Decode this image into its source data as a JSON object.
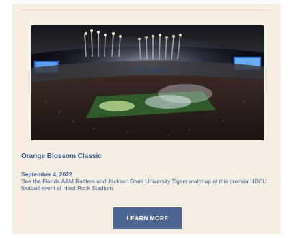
{
  "event": {
    "image_alt": "Hard Rock Stadium at night with fireworks above the field",
    "title": "Orange Blossom Classic",
    "date": "September 4, 2022",
    "description": "See the Florida A&M Rattlers and Jackson State University Tigers matchup at this premier HBCU football event at Hard Rock Stadium.",
    "cta_label": "LEARN MORE"
  },
  "colors": {
    "card_background": "#f5eee3",
    "accent_text": "#3b5b92",
    "button": "#4c6691",
    "divider": "#e9a48f"
  }
}
